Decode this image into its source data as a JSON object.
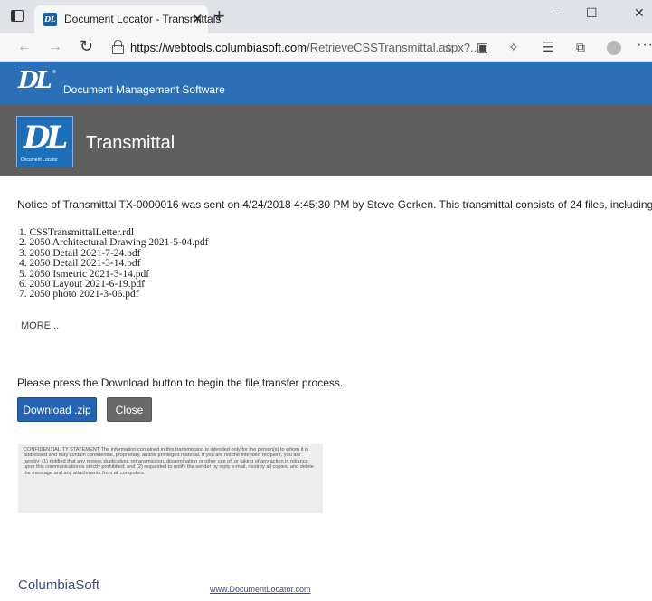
{
  "browser": {
    "tab_title": "Document Locator - Transmittals",
    "tab_favicon_text": "DL",
    "tab_close": "✕",
    "new_tab": "+",
    "window_controls": {
      "minimize": "–",
      "maximize": "☐",
      "close": "✕"
    },
    "url_host": "https://webtools.columbiasoft.com",
    "url_path": "/RetrieveCSSTransmittal.aspx?...",
    "icons": [
      "tab-actions-icon",
      "back-icon",
      "forward-icon",
      "refresh-icon",
      "lock-icon",
      "favorite-icon",
      "shield-icon",
      "extensions-icon",
      "favorites-list-icon",
      "collections-icon",
      "profile-icon",
      "more-icon"
    ]
  },
  "header": {
    "logo_text": "DL",
    "tm": "®",
    "product_name": "Document Management Software"
  },
  "title_bar": {
    "logo_text": "DL",
    "logo_caption": "Document Locator",
    "title": "Transmittal"
  },
  "notice": "Notice of Transmittal TX-0000016 was sent on 4/24/2018 4:45:30 PM by Steve Gerken. This transmittal consists of 24 files, including:",
  "files": [
    "1. CSSTransmittalLetter.rdl",
    "2. 2050 Architectural Drawing 2021-5-04.pdf",
    "3. 2050 Detail 2021-7-24.pdf",
    "4. 2050 Detail 2021-3-14.pdf",
    "5. 2050 Ismetric 2021-3-14.pdf",
    "6. 2050 Layout 2021-6-19.pdf",
    "7. 2050 photo 2021-3-06.pdf"
  ],
  "more_label": "MORE...",
  "instructions": "Please press the Download button to begin the file transfer process.",
  "buttons": {
    "download": "Download .zip",
    "close": "Close"
  },
  "confidentiality": "CONFIDENTIALITY STATEMENT The information contained in this transmission is intended only for the person(s) to whom it is addressed and may contain confidential, proprietary, and/or privileged material. If you are not the intended recipient, you are hereby: (1) notified that any review, duplication, retransmission, dissemination or other use of, or taking of any action in reliance upon this communication is strictly prohibited; and (2) requested to notify the sender by reply e-mail, destroy all copies, and delete the message and any attachments from all computers.",
  "footer": {
    "brand": "ColumbiaSoft",
    "link": "www.DocumentLocator.com"
  },
  "colors": {
    "brand_blue": "#2b70b7",
    "title_gray": "#5f5f5f",
    "download_button": "#2563b5",
    "close_button": "#6a6a6a"
  }
}
